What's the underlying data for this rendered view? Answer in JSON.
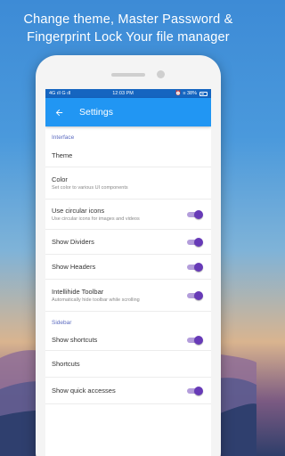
{
  "headline": {
    "line1": "Change theme, Master Password &",
    "line2": "Fingerprint Lock Your file manager"
  },
  "status_bar": {
    "left": "4G ıll  G ıll",
    "time": "12:03 PM",
    "right": "⏰ ≡ 38%"
  },
  "app_bar": {
    "title": "Settings",
    "back_icon": "arrow-back-icon"
  },
  "colors": {
    "app_bar": "#2196f3",
    "status_bar": "#1565c0",
    "section_header": "#5c6bc0",
    "toggle_on": "#673ab7"
  },
  "sections": {
    "interface": "Interface",
    "sidebar": "Sidebar"
  },
  "rows": {
    "theme": {
      "label": "Theme"
    },
    "color": {
      "label": "Color",
      "sub": "Set color to various UI components"
    },
    "circular_icons": {
      "label": "Use circular icons",
      "sub": "Use circular icons for images and videos",
      "on": true
    },
    "show_dividers": {
      "label": "Show Dividers",
      "on": true
    },
    "show_headers": {
      "label": "Show Headers",
      "on": true
    },
    "intellihide": {
      "label": "Intellihide Toolbar",
      "sub": "Automatically hide toolbar while scrolling",
      "on": true
    },
    "show_shortcuts": {
      "label": "Show shortcuts",
      "on": true
    },
    "shortcuts": {
      "label": "Shortcuts"
    },
    "quick_accesses": {
      "label": "Show quick accesses",
      "on": true
    }
  }
}
